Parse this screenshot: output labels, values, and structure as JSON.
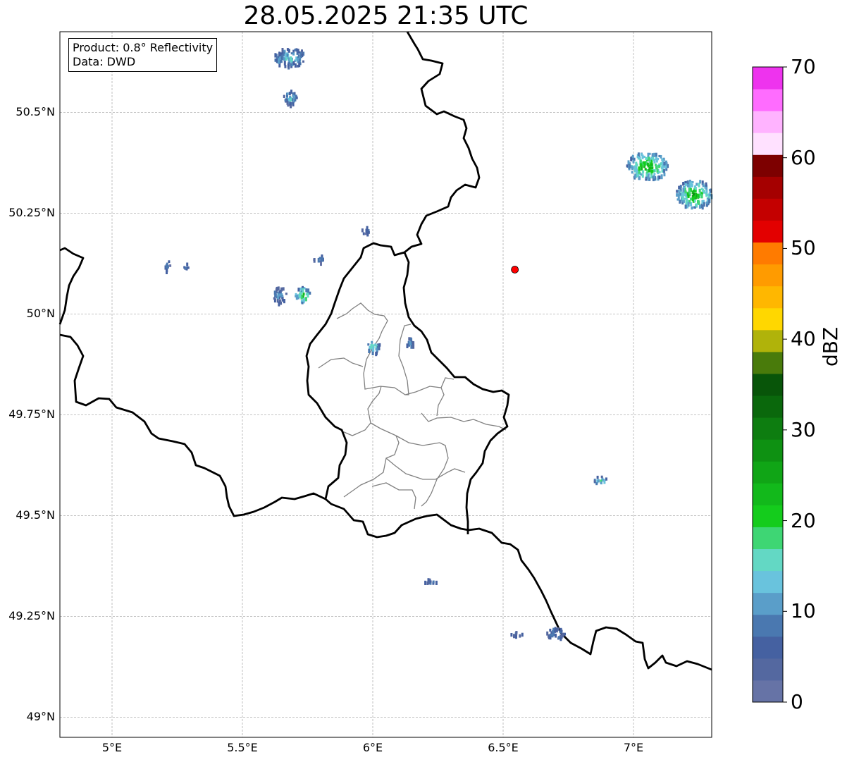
{
  "title": "28.05.2025 21:35 UTC",
  "info": {
    "product_line": "Product: 0.8° Reflectivity",
    "data_line": "Data: DWD"
  },
  "axes": {
    "lon_ticks": [
      {
        "value": 5.0,
        "label": "5°E"
      },
      {
        "value": 5.5,
        "label": "5.5°E"
      },
      {
        "value": 6.0,
        "label": "6°E"
      },
      {
        "value": 6.5,
        "label": "6.5°E"
      },
      {
        "value": 7.0,
        "label": "7°E"
      }
    ],
    "lat_ticks": [
      {
        "value": 50.5,
        "label": "50.5°N"
      },
      {
        "value": 50.25,
        "label": "50.25°N"
      },
      {
        "value": 50.0,
        "label": "50°N"
      },
      {
        "value": 49.75,
        "label": "49.75°N"
      },
      {
        "value": 49.5,
        "label": "49.5°N"
      },
      {
        "value": 49.25,
        "label": "49.25°N"
      },
      {
        "value": 49.0,
        "label": "49°N"
      }
    ],
    "extent": {
      "lon_min": 4.8,
      "lon_max": 7.3,
      "lat_min": 48.95,
      "lat_max": 50.7
    },
    "grid": true
  },
  "colorbar": {
    "label": "dBZ",
    "ticks": [
      "0",
      "10",
      "20",
      "30",
      "40",
      "50",
      "60",
      "70"
    ],
    "range": [
      0,
      70
    ],
    "colors": [
      "#6673a6",
      "#5468a0",
      "#4561a1",
      "#4a78b0",
      "#5a9ec9",
      "#69c3dd",
      "#63d8c4",
      "#3ed674",
      "#14cc1c",
      "#12b91b",
      "#10a516",
      "#0e9112",
      "#0d7d10",
      "#0a680c",
      "#085509",
      "#497b0b",
      "#b0b30a",
      "#ffd700",
      "#ffb700",
      "#ff9b00",
      "#ff7b00",
      "#e30000",
      "#c40000",
      "#a50000",
      "#7d0000",
      "#ffe1ff",
      "#ffb3ff",
      "#ff6cff",
      "#ee33ee"
    ]
  },
  "radar_marker": {
    "lon": 6.545,
    "lat": 50.11,
    "color": "#ff0000"
  },
  "echoes": [
    {
      "lon": 5.68,
      "lat": 50.64,
      "w": 0.12,
      "h": 0.05,
      "peak_dbz": 15
    },
    {
      "lon": 5.68,
      "lat": 50.54,
      "w": 0.05,
      "h": 0.04,
      "peak_dbz": 15
    },
    {
      "lon": 5.21,
      "lat": 50.12,
      "w": 0.02,
      "h": 0.03,
      "peak_dbz": 10
    },
    {
      "lon": 5.28,
      "lat": 50.12,
      "w": 0.02,
      "h": 0.02,
      "peak_dbz": 10
    },
    {
      "lon": 5.64,
      "lat": 50.05,
      "w": 0.05,
      "h": 0.04,
      "peak_dbz": 12
    },
    {
      "lon": 5.73,
      "lat": 50.05,
      "w": 0.06,
      "h": 0.04,
      "peak_dbz": 25
    },
    {
      "lon": 5.79,
      "lat": 50.14,
      "w": 0.04,
      "h": 0.02,
      "peak_dbz": 10
    },
    {
      "lon": 5.97,
      "lat": 50.21,
      "w": 0.03,
      "h": 0.02,
      "peak_dbz": 10
    },
    {
      "lon": 6.0,
      "lat": 49.92,
      "w": 0.06,
      "h": 0.03,
      "peak_dbz": 17
    },
    {
      "lon": 6.14,
      "lat": 49.93,
      "w": 0.03,
      "h": 0.03,
      "peak_dbz": 10
    },
    {
      "lon": 7.05,
      "lat": 50.37,
      "w": 0.16,
      "h": 0.07,
      "peak_dbz": 25
    },
    {
      "lon": 7.23,
      "lat": 50.3,
      "w": 0.14,
      "h": 0.07,
      "peak_dbz": 25
    },
    {
      "lon": 6.87,
      "lat": 49.59,
      "w": 0.05,
      "h": 0.02,
      "peak_dbz": 17
    },
    {
      "lon": 6.22,
      "lat": 49.34,
      "w": 0.06,
      "h": 0.01,
      "peak_dbz": 10
    },
    {
      "lon": 6.7,
      "lat": 49.21,
      "w": 0.07,
      "h": 0.03,
      "peak_dbz": 10
    },
    {
      "lon": 6.55,
      "lat": 49.21,
      "w": 0.05,
      "h": 0.01,
      "peak_dbz": 10
    }
  ]
}
